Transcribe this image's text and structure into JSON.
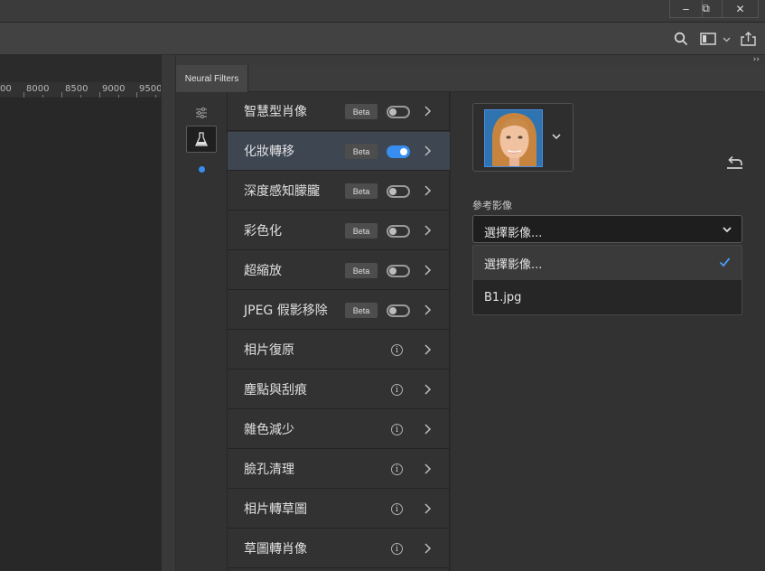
{
  "window_controls": {
    "minimize": "‒",
    "restore": "⧉",
    "close": "✕"
  },
  "options_bar": {
    "icons": [
      "search-icon",
      "workspace-icon",
      "share-icon"
    ]
  },
  "ruler": {
    "ticks": [
      "00",
      "8000",
      "8500",
      "9000",
      "9500"
    ]
  },
  "panel": {
    "tab_label": "Neural Filters",
    "collapse": "››"
  },
  "sidebar": {
    "icons": [
      "sliders-icon",
      "beaker-icon"
    ],
    "accent": "#378ef0"
  },
  "filters": [
    {
      "label": "智慧型肖像",
      "badge": "Beta",
      "toggle": false
    },
    {
      "label": "化妝轉移",
      "badge": "Beta",
      "toggle": true,
      "selected": true
    },
    {
      "label": "深度感知朦朧",
      "badge": "Beta",
      "toggle": false
    },
    {
      "label": "彩色化",
      "badge": "Beta",
      "toggle": false
    },
    {
      "label": "超縮放",
      "badge": "Beta",
      "toggle": false
    },
    {
      "label": "JPEG 假影移除",
      "badge": "Beta",
      "toggle": false
    },
    {
      "label": "相片復原",
      "info": "i"
    },
    {
      "label": "塵點與刮痕",
      "info": "i"
    },
    {
      "label": "雜色減少",
      "info": "i"
    },
    {
      "label": "臉孔清理",
      "info": "i"
    },
    {
      "label": "相片轉草圖",
      "info": "i"
    },
    {
      "label": "草圖轉肖像",
      "info": "i"
    }
  ],
  "detail": {
    "reference_label": "參考影像",
    "select_value": "選擇影像...",
    "menu_items": [
      {
        "label": "選擇影像...",
        "checked": true
      },
      {
        "label": "B1.jpg",
        "checked": false
      }
    ]
  }
}
